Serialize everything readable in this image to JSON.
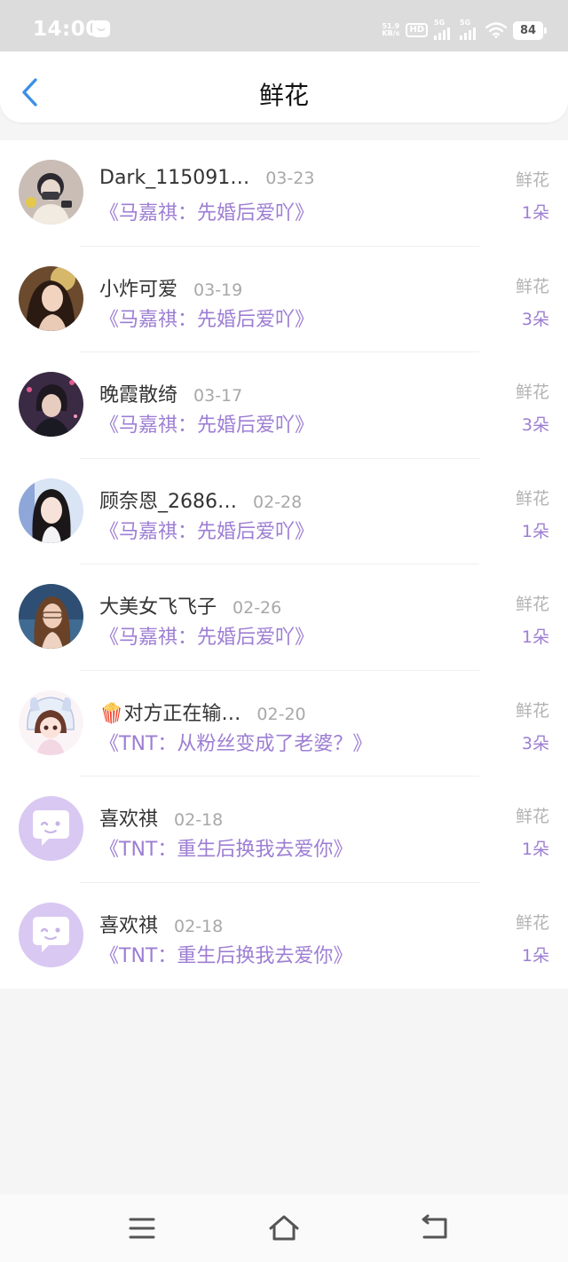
{
  "status_bar": {
    "time": "14:00",
    "net_speed_value": "51.9",
    "net_speed_unit": "KB/s",
    "hd_label": "HD",
    "network_1": "5G",
    "network_2": "5G",
    "battery": "84"
  },
  "header": {
    "title": "鲜花",
    "back_icon": "chevron-left-icon"
  },
  "items": [
    {
      "name": "Dark_115091…",
      "date": "03-23",
      "book": "《马嘉祺：先婚后爱吖》",
      "gift_label": "鲜花",
      "gift_count": "1朵",
      "avatar": "photo"
    },
    {
      "name": "小炸可爱",
      "date": "03-19",
      "book": "《马嘉祺：先婚后爱吖》",
      "gift_label": "鲜花",
      "gift_count": "3朵",
      "avatar": "photo"
    },
    {
      "name": "晚霞散绮",
      "date": "03-17",
      "book": "《马嘉祺：先婚后爱吖》",
      "gift_label": "鲜花",
      "gift_count": "3朵",
      "avatar": "photo"
    },
    {
      "name": "顾奈恩_2686…",
      "date": "02-28",
      "book": "《马嘉祺：先婚后爱吖》",
      "gift_label": "鲜花",
      "gift_count": "1朵",
      "avatar": "photo"
    },
    {
      "name": "大美女飞飞子",
      "date": "02-26",
      "book": "《马嘉祺：先婚后爱吖》",
      "gift_label": "鲜花",
      "gift_count": "1朵",
      "avatar": "photo"
    },
    {
      "name": "🍿对方正在输…",
      "date": "02-20",
      "book": "《TNT：从粉丝变成了老婆？》",
      "gift_label": "鲜花",
      "gift_count": "3朵",
      "avatar": "photo"
    },
    {
      "name": "喜欢祺",
      "date": "02-18",
      "book": "《TNT：重生后换我去爱你》",
      "gift_label": "鲜花",
      "gift_count": "1朵",
      "avatar": "default-chat-avatar-icon"
    },
    {
      "name": "喜欢祺",
      "date": "02-18",
      "book": "《TNT：重生后换我去爱你》",
      "gift_label": "鲜花",
      "gift_count": "1朵",
      "avatar": "default-chat-avatar-icon"
    }
  ],
  "nav_bar": {
    "icons": [
      "menu-icon",
      "home-icon",
      "back-icon"
    ]
  },
  "colors": {
    "accent_purple": "#9d7ed3",
    "back_arrow_blue": "#3d8fe6",
    "default_avatar_bg": "#d9c8f2"
  }
}
